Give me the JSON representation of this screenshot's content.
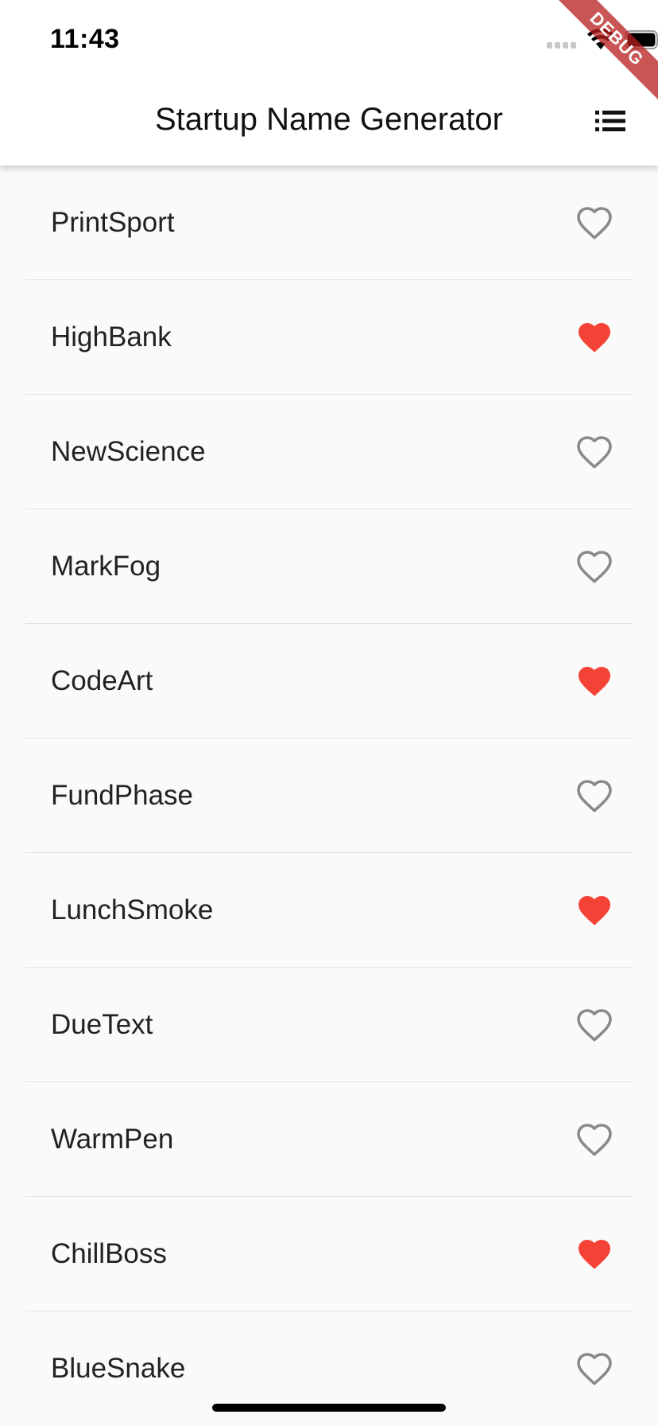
{
  "status_bar": {
    "time": "11:43",
    "icons": [
      "signal-icon",
      "wifi-icon",
      "battery-icon"
    ]
  },
  "debug_banner": {
    "label": "DEBUG"
  },
  "app_bar": {
    "title": "Startup Name Generator",
    "action_icon": "list-icon"
  },
  "colors": {
    "favorite": "#f44336",
    "heart_outline": "#8a8a8a",
    "app_bar_bg": "#ffffff",
    "list_bg": "#fafafa"
  },
  "names": [
    {
      "label": "PrintSport",
      "saved": false
    },
    {
      "label": "HighBank",
      "saved": true
    },
    {
      "label": "NewScience",
      "saved": false
    },
    {
      "label": "MarkFog",
      "saved": false
    },
    {
      "label": "CodeArt",
      "saved": true
    },
    {
      "label": "FundPhase",
      "saved": false
    },
    {
      "label": "LunchSmoke",
      "saved": true
    },
    {
      "label": "DueText",
      "saved": false
    },
    {
      "label": "WarmPen",
      "saved": false
    },
    {
      "label": "ChillBoss",
      "saved": true
    },
    {
      "label": "BlueSnake",
      "saved": false
    }
  ]
}
